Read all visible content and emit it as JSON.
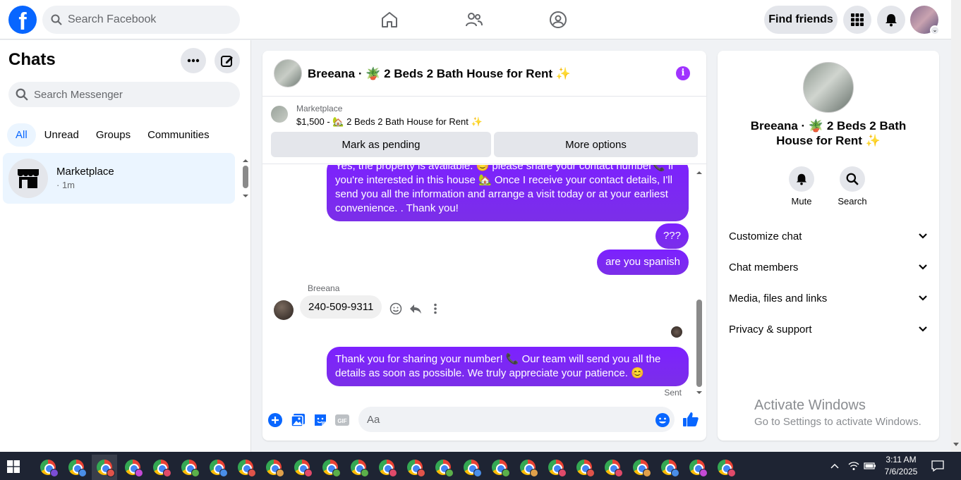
{
  "topnav": {
    "search_placeholder": "Search Facebook",
    "find_friends_label": "Find friends"
  },
  "sidebar": {
    "title": "Chats",
    "search_placeholder": "Search Messenger",
    "filters": [
      "All",
      "Unread",
      "Groups",
      "Communities"
    ],
    "active_filter": "All",
    "chats": [
      {
        "name": "Marketplace",
        "time": "· 1m"
      }
    ]
  },
  "conversation": {
    "title": "Breeana · 🪴 2 Beds 2 Bath House for Rent ✨",
    "marketplace": {
      "label": "Marketplace",
      "listing": "$1,500 - 🏡 2 Beds 2 Bath House for Rent ✨",
      "mark_pending_label": "Mark as pending",
      "more_options_label": "More options"
    },
    "messages": [
      {
        "from": "me",
        "text": "Yes, the property is  available. 😊 please share your contact number📞 if you're interested in this house 🏡 Once I receive your contact details, I'll send you all the information and arrange a visit today or at your earliest convenience. .                    Thank you!"
      },
      {
        "from": "me",
        "text": "???"
      },
      {
        "from": "me",
        "text": "are you spanish"
      },
      {
        "from": "Breeana",
        "sender_label": "Breeana",
        "text": "240-509-9311"
      },
      {
        "from": "me",
        "text": "Thank you for sharing your number! 📞 Our team will send you all the details as soon as possible. We truly appreciate your patience. 😊"
      }
    ],
    "status": "Sent",
    "composer_placeholder": "Aa"
  },
  "info_panel": {
    "name": "Breeana · 🪴 2 Beds 2 Bath House for Rent ✨",
    "actions": [
      {
        "label": "Mute",
        "icon": "bell-icon"
      },
      {
        "label": "Search",
        "icon": "search-icon"
      }
    ],
    "sections": [
      "Customize chat",
      "Chat members",
      "Media, files and links",
      "Privacy & support"
    ]
  },
  "watermark": {
    "line1": "Activate Windows",
    "line2": "Go to Settings to activate Windows."
  },
  "taskbar": {
    "time": "3:11 AM",
    "date": "7/6/2025",
    "app_count": 26,
    "profile_dot_colors": [
      "#7b4dd6",
      "#4a8ee8",
      "#e0534a",
      "#c44ad6",
      "#e04a6a",
      "#5bb04a",
      "#4a8ee8",
      "#e0534a",
      "#e0a04a",
      "#e04a6a",
      "#5bb04a",
      "#5bb04a",
      "#e04a6a",
      "#e0534a",
      "#5bb04a",
      "#4a8ee8",
      "#5bb04a",
      "#e0a04a",
      "#e04a6a",
      "#e0534a",
      "#e04a6a",
      "#e0a04a",
      "#4a8ee8",
      "#c44ad6",
      "#e04a6a"
    ]
  },
  "colors": {
    "brand_blue": "#0866ff",
    "message_purple": "#7c21ff",
    "info_purple": "#a033ff"
  }
}
